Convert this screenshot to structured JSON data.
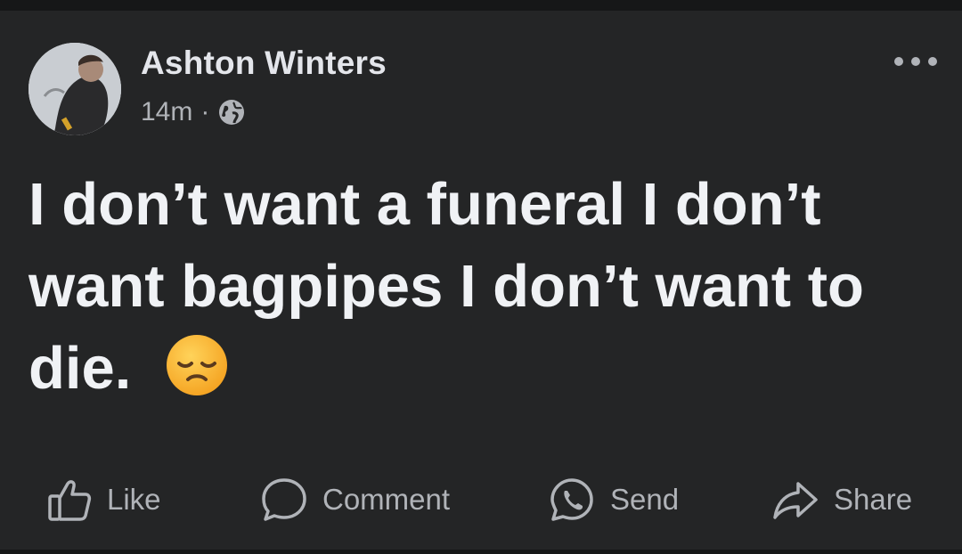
{
  "post": {
    "author": "Ashton Winters",
    "time": "14m",
    "separator": "·",
    "privacy_icon": "globe-icon",
    "text": "I don’t want a funeral I don’t want bagpipes I don’t want to die.",
    "emoji": "disappointed-face-emoji"
  },
  "actions": {
    "like_label": "Like",
    "comment_label": "Comment",
    "send_label": "Send",
    "share_label": "Share"
  },
  "colors": {
    "background": "#242526",
    "primary_text": "#e4e6eb",
    "secondary_text": "#b0b3b8"
  }
}
